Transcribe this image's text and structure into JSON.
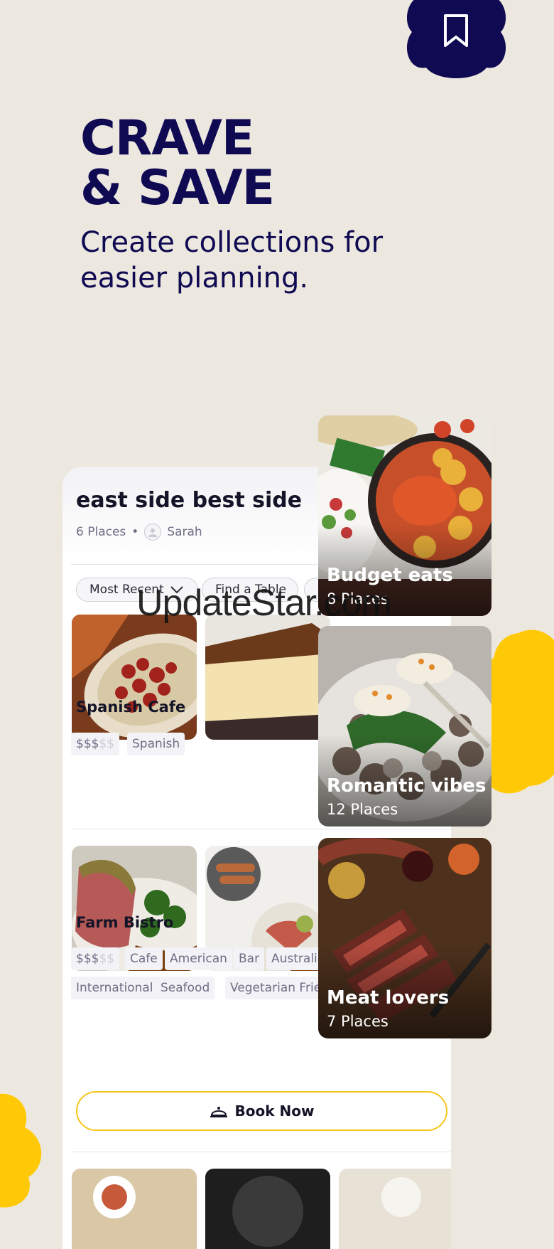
{
  "hero": {
    "title_line1": "CRAVE",
    "title_line2": "& SAVE",
    "subtitle": "Create collections for easier planning."
  },
  "icons": {
    "bookmark": "bookmark-icon",
    "avatar": "user-avatar-icon",
    "chevron": "chevron-down-icon",
    "book": "cloche-icon"
  },
  "colors": {
    "background": "#ede8df",
    "navy": "#0f0a52",
    "accent_yellow": "#ffc907",
    "button_border": "#f5c518"
  },
  "collection": {
    "name": "east side best side",
    "places": "6 Places",
    "separator": "•",
    "owner": "Sarah",
    "filters": [
      "Most Recent",
      "Find a Table"
    ]
  },
  "restaurants": [
    {
      "name": "Spanish Cafe",
      "price_active": "$$$",
      "price_inactive": "$$",
      "tags": [
        "Spanish"
      ]
    },
    {
      "name": "Farm Bistro",
      "price_active": "$$$",
      "price_inactive": "$$",
      "tags": [
        "Cafe",
        "American",
        "Bar",
        "Australian",
        "International",
        "Seafood",
        "Vegetarian Friendly"
      ]
    }
  ],
  "book_now_label": "Book Now",
  "tiles": [
    {
      "name": "Budget eats",
      "count": "8 Places"
    },
    {
      "name": "Romantic vibes",
      "count": "12 Places"
    },
    {
      "name": "Meat lovers",
      "count": "7 Places"
    }
  ],
  "watermark": "UpdateStar.com"
}
